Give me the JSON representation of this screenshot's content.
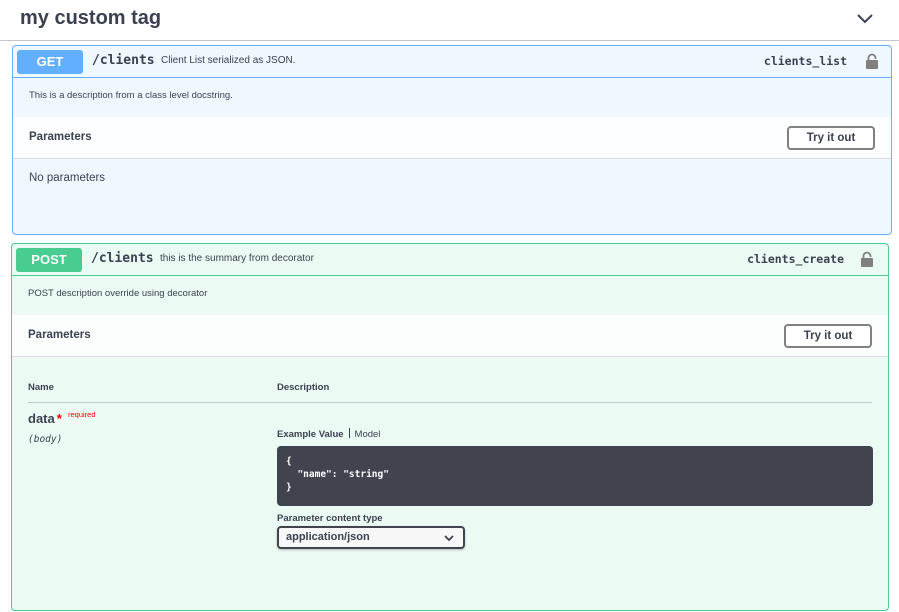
{
  "tag": {
    "title": "my custom tag"
  },
  "get_op": {
    "method": "GET",
    "path": "/clients",
    "summary": "Client List serialized as JSON.",
    "operation_id": "clients_list",
    "description": "This is a description from a class level docstring.",
    "parameters_title": "Parameters",
    "try_button": "Try it out",
    "no_params": "No parameters"
  },
  "post_op": {
    "method": "POST",
    "path": "/clients",
    "summary": "this is the summary from decorator",
    "operation_id": "clients_create",
    "description": "POST description override using decorator",
    "parameters_title": "Parameters",
    "try_button": "Try it out",
    "columns": {
      "name": "Name",
      "description": "Description"
    },
    "param": {
      "name": "data",
      "required_star": "*",
      "required_label": "required",
      "location": "(body)"
    },
    "example_tabs": {
      "example_value": "Example Value",
      "model": "Model"
    },
    "example_code": "{\n  \"name\": \"string\"\n}",
    "content_type": {
      "label": "Parameter content type",
      "selected": "application/json"
    }
  },
  "colors": {
    "get": "#61affe",
    "post": "#49cc90",
    "text": "#3b4151",
    "required": "#ff0000",
    "code_bg": "#41444e"
  },
  "icons": {
    "tag_toggle": "chevron-down-icon",
    "lock": "lock-icon",
    "select": "chevron-down-icon"
  }
}
